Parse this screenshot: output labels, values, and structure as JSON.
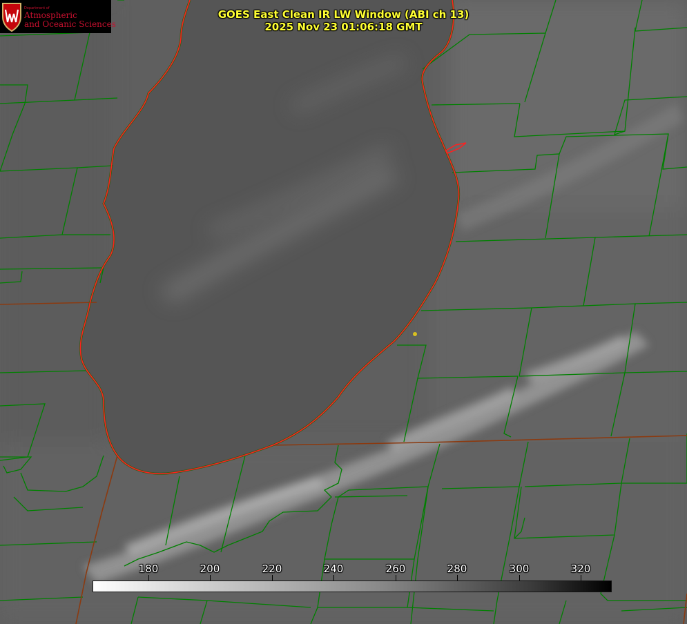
{
  "header": {
    "title_line1": "GOES East Clean IR LW Window (ABI ch 13)",
    "title_line2": "2025 Nov 23 01:06:18 GMT"
  },
  "logo": {
    "dept": "Department of",
    "line1": "Atmospheric",
    "line2": "and Oceanic Sciences",
    "emblem": "uw-crest-icon"
  },
  "colorbar": {
    "ticks": [
      "180",
      "200",
      "220",
      "240",
      "260",
      "280",
      "300",
      "320"
    ]
  },
  "colors": {
    "county_lines": "#008000",
    "lake_outline": "#ff2020",
    "title_text": "#ffff33",
    "marker": "#d8c020"
  }
}
